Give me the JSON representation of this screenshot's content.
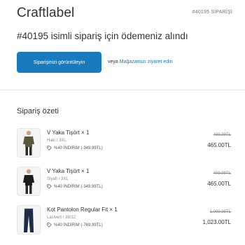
{
  "header": {
    "brand": "Craftlabel",
    "order_ref": "#40195 SİPARİŞİ"
  },
  "main": {
    "thanks": "#40195 isimli sipariş için ödemeniz alındı",
    "view_order_button": "Siparişinizi görüntüleyin",
    "or_text": "veya",
    "store_link": "Mağazamızı ziyaret edin"
  },
  "summary": {
    "title": "Sipariş özeti",
    "items": [
      {
        "name": "V Yaka Tişört × 1",
        "variant": "Haki / 3XL",
        "discount": "%40 İNDİRİM (-349.99TL)",
        "old_price": "499.99TL",
        "price": "465.00TL",
        "icon": "tshirt-image",
        "color": "#5a5a3a"
      },
      {
        "name": "V Yaka Tişört × 1",
        "variant": "Siyah / 3XL",
        "discount": "%40 İNDİRİM (-349.99TL)",
        "old_price": "499.99TL",
        "price": "465.00TL",
        "icon": "tshirt-image",
        "color": "#1c1c1c"
      },
      {
        "name": "Kot Pantolon Regular Fit × 1",
        "variant": "Lacivert / 38/32",
        "discount": "%40 İNDİRİM (-769.99TL)",
        "old_price": "1,099.99TL",
        "price": "1,023.00TL",
        "icon": "jeans-image",
        "color": "#1f2a44"
      }
    ]
  },
  "colors": {
    "accent": "#197bbd",
    "text": "#333333",
    "muted": "#8a8a8a"
  }
}
